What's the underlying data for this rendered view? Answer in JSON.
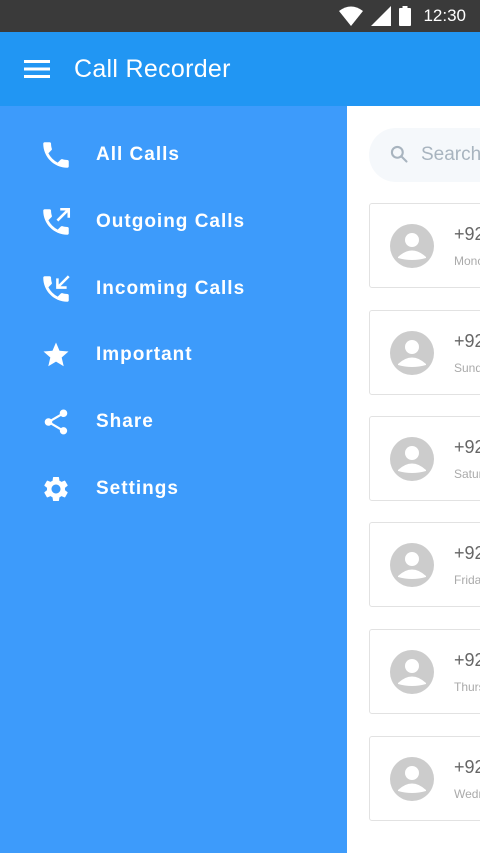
{
  "status_bar": {
    "time": "12:30"
  },
  "app_bar": {
    "title": "Call Recorder"
  },
  "drawer": {
    "items": [
      {
        "label": "All Calls",
        "icon": "phone-icon"
      },
      {
        "label": "Outgoing Calls",
        "icon": "outgoing-call-icon"
      },
      {
        "label": "Incoming Calls",
        "icon": "incoming-call-icon"
      },
      {
        "label": "Important",
        "icon": "star-icon"
      },
      {
        "label": "Share",
        "icon": "share-icon"
      },
      {
        "label": "Settings",
        "icon": "gear-icon"
      }
    ]
  },
  "search": {
    "placeholder": "Search"
  },
  "calls": [
    {
      "number": "+92",
      "day": "Monc"
    },
    {
      "number": "+92",
      "day": "Sund"
    },
    {
      "number": "+92",
      "day": "Satur"
    },
    {
      "number": "+92",
      "day": "Frida"
    },
    {
      "number": "+92",
      "day": "Thurs"
    },
    {
      "number": "+92",
      "day": "Wedr"
    }
  ],
  "colors": {
    "status_bar": "#3a3a3a",
    "app_bar": "#2196f3",
    "drawer": "#3d9bfb",
    "avatar": "#cccccc"
  }
}
